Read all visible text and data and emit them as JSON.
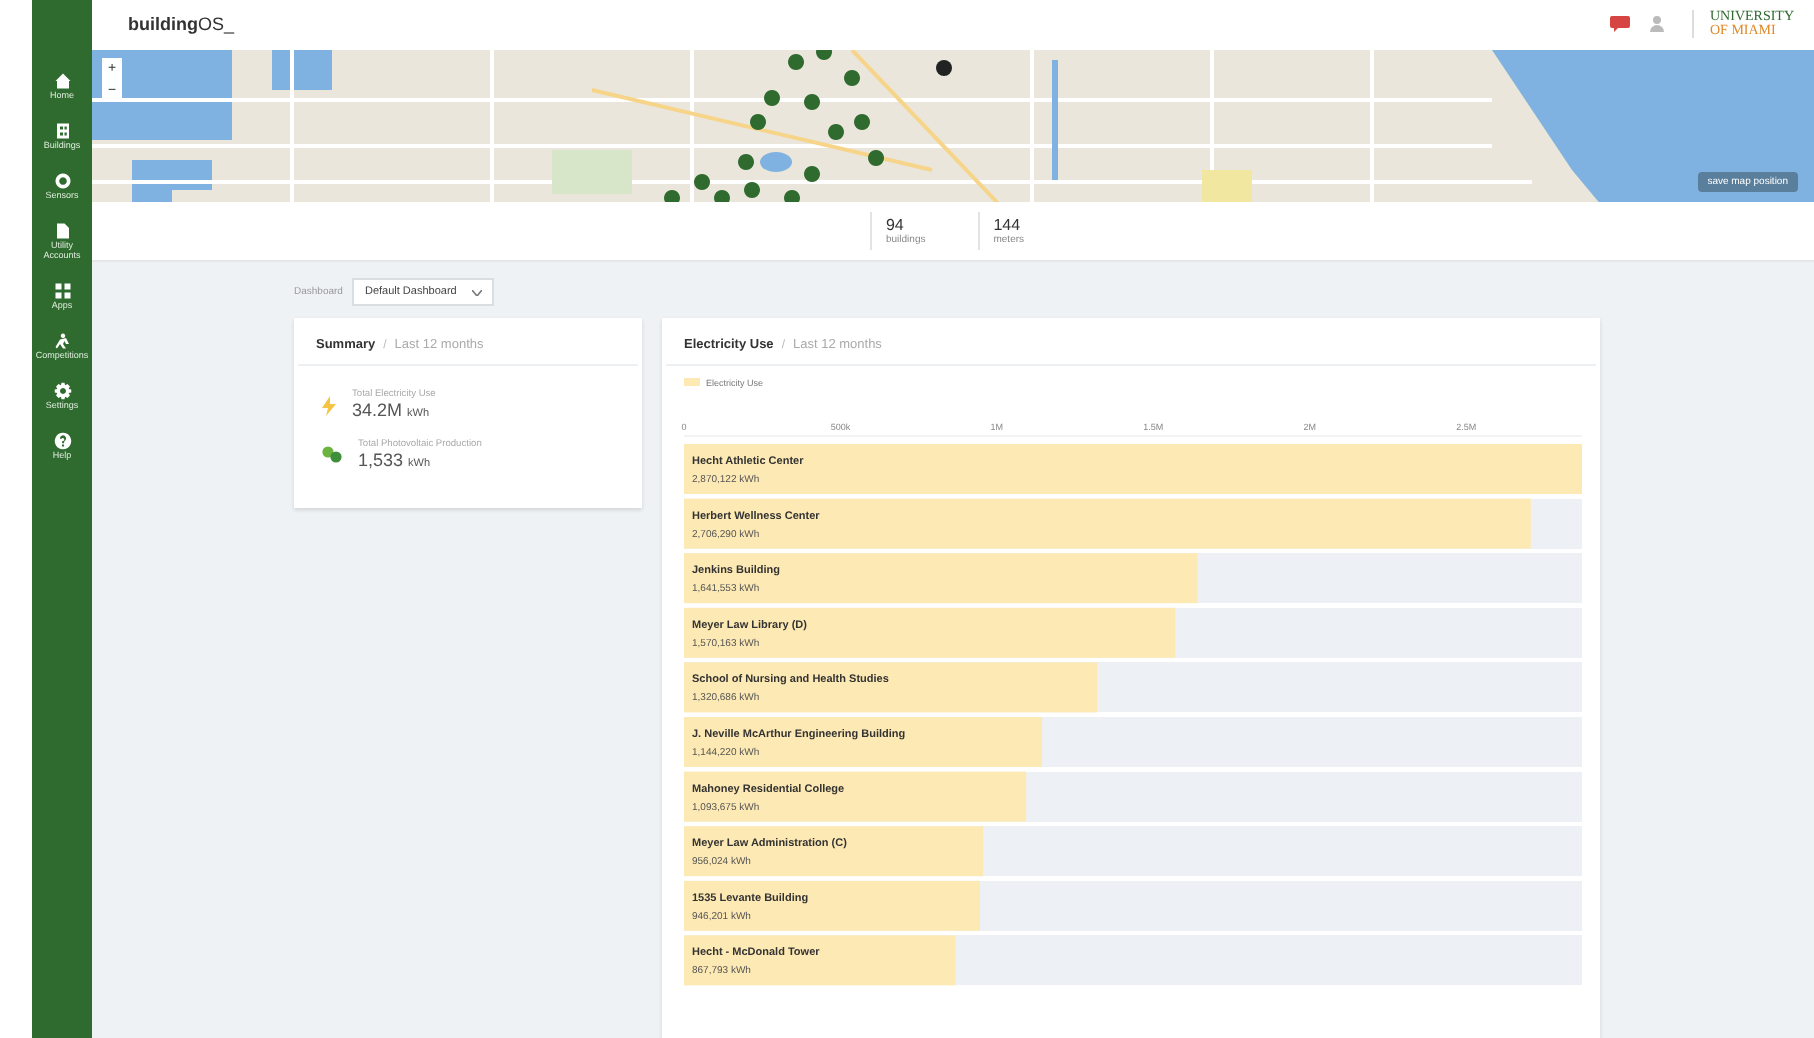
{
  "header": {
    "logo": "**building**OS_",
    "university_logo": [
      "UNIVERSITY",
      "OF MIAMI"
    ]
  },
  "sidebar": {
    "items": [
      {
        "label": "Home"
      },
      {
        "label": "Buildings"
      },
      {
        "label": "Sensors"
      },
      {
        "label": "Utility Accounts"
      },
      {
        "label": "Apps"
      },
      {
        "label": "Competitions"
      },
      {
        "label": "Settings"
      },
      {
        "label": "Help"
      }
    ]
  },
  "map": {
    "zoom_in": "+",
    "zoom_out": "−",
    "save_button": "save map position"
  },
  "stats": [
    {
      "value": "94",
      "label": "buildings"
    },
    {
      "value": "144",
      "label": "meters"
    }
  ],
  "dashboard": {
    "label": "Dashboard",
    "value": "Default Dashboard"
  },
  "summary": {
    "title": "Summary",
    "separator": "/",
    "period": "Last 12 months",
    "items": [
      {
        "label": "Total Electricity Use",
        "value": "34.2M",
        "unit": "kWh"
      },
      {
        "label": "Total Photovoltaic Production",
        "value": "1,533",
        "unit": "kWh"
      }
    ]
  },
  "electricity": {
    "title": "Electricity Use",
    "separator": "/",
    "period": "Last 12 months",
    "chart_data": {
      "type": "bar",
      "orientation": "horizontal",
      "categories": [
        "Hecht Athletic Center",
        "Herbert Wellness Center",
        "Jenkins Building",
        "Meyer Law Library (D)",
        "School of Nursing and Health Studies",
        "J. Neville McArthur Engineering Building",
        "Mahoney Residential College",
        "Meyer Law Administration (C)",
        "1535 Levante Building",
        "Hecht - McDonald Tower"
      ],
      "series": [
        {
          "name": "Electricity Use",
          "color": "#fde9b3",
          "values": [
            2870122,
            2706290,
            1641553,
            1570163,
            1320686,
            1144220,
            1093675,
            956024,
            946201,
            867793
          ]
        }
      ],
      "xlim": [
        0,
        2870122
      ],
      "xticks": [
        {
          "value": 0,
          "label": "0"
        },
        {
          "value": 500000,
          "label": "500k"
        },
        {
          "value": 1000000,
          "label": "1M"
        },
        {
          "value": 1500000,
          "label": "1.5M"
        },
        {
          "value": 2000000,
          "label": "2M"
        },
        {
          "value": 2500000,
          "label": "2.5M"
        }
      ],
      "value_labels": [
        "2,870,122 kWh",
        "2,706,290 kWh",
        "1,641,553 kWh",
        "1,570,163 kWh",
        "1,320,686 kWh",
        "1,144,220 kWh",
        "1,093,675 kWh",
        "956,024 kWh",
        "946,201 kWh",
        "867,793 kWh"
      ]
    }
  }
}
